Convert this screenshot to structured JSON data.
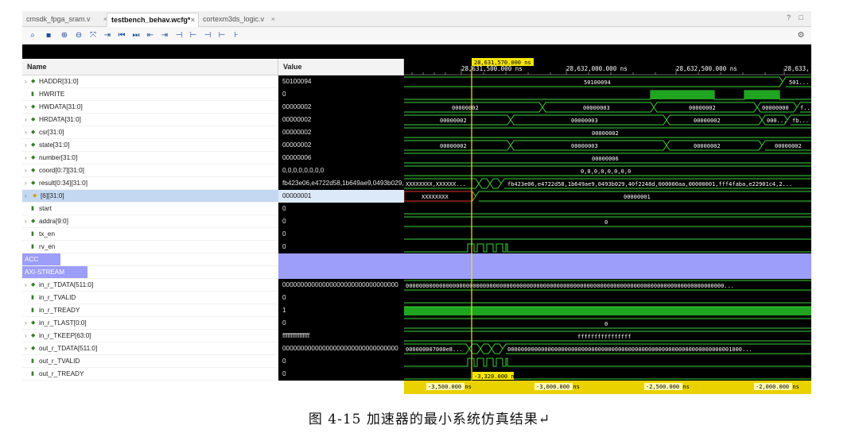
{
  "tabs": [
    {
      "label": "cmsdk_fpga_sram.v",
      "active": false
    },
    {
      "label": "testbench_behav.wcfg*",
      "active": true
    },
    {
      "label": "cortexm3ds_logic.v",
      "active": false
    }
  ],
  "tab_close_glyph": "×",
  "window_controls": "? □",
  "columns": {
    "name": "Name",
    "value": "Value"
  },
  "signals": [
    {
      "name": "HADDR[31:0]",
      "value": "50100094",
      "kind": "bus",
      "expandable": true
    },
    {
      "name": "HWRITE",
      "value": "0",
      "kind": "bit",
      "expandable": false
    },
    {
      "name": "HWDATA[31:0]",
      "value": "00000002",
      "kind": "bus",
      "expandable": true
    },
    {
      "name": "HRDATA[31:0]",
      "value": "00000002",
      "kind": "bus",
      "expandable": true
    },
    {
      "name": "csr[31:0]",
      "value": "00000002",
      "kind": "bus",
      "expandable": true
    },
    {
      "name": "state[31:0]",
      "value": "00000002",
      "kind": "bus",
      "expandable": true
    },
    {
      "name": "number[31:0]",
      "value": "00000006",
      "kind": "bus",
      "expandable": true
    },
    {
      "name": "coord[0:7][31:0]",
      "value": "0,0,0,0,0,0,0,0",
      "kind": "bus",
      "expandable": true
    },
    {
      "name": "result[0:34][31:0]",
      "value": "fb423e06,e4722d58,1b649ae9,0493b029,4",
      "kind": "bus",
      "expandable": true
    },
    {
      "name": "[6][31:0]",
      "value": "00000001",
      "kind": "bus",
      "expandable": true,
      "selected": true
    },
    {
      "name": "start",
      "value": "0",
      "kind": "bit",
      "expandable": false
    },
    {
      "name": "addra[9:0]",
      "value": "0",
      "kind": "bus",
      "expandable": true
    },
    {
      "name": "tx_en",
      "value": "0",
      "kind": "bit",
      "expandable": false
    },
    {
      "name": "rv_en",
      "value": "0",
      "kind": "bit",
      "expandable": false
    },
    {
      "name": "ACC",
      "value": "",
      "kind": "group",
      "expandable": false
    },
    {
      "name": "AXI-STREAM",
      "value": "",
      "kind": "group",
      "expandable": false
    },
    {
      "name": "in_r_TDATA[511:0]",
      "value": "00000000000000000000000000000000",
      "kind": "bus",
      "expandable": true
    },
    {
      "name": "in_r_TVALID",
      "value": "0",
      "kind": "bit",
      "expandable": false
    },
    {
      "name": "in_r_TREADY",
      "value": "1",
      "kind": "bit",
      "expandable": false
    },
    {
      "name": "in_r_TLAST[0:0]",
      "value": "0",
      "kind": "bus",
      "expandable": true
    },
    {
      "name": "in_r_TKEEP[63:0]",
      "value": "ffffffffffffffff",
      "kind": "bus",
      "expandable": true
    },
    {
      "name": "out_r_TDATA[511:0]",
      "value": "00000000000000000000000000000000",
      "kind": "bus",
      "expandable": true
    },
    {
      "name": "out_r_TVALID",
      "value": "0",
      "kind": "bit",
      "expandable": false
    },
    {
      "name": "out_r_TREADY",
      "value": "0",
      "kind": "bit",
      "expandable": false
    }
  ],
  "timeline": {
    "cursor_time": "28,631,570.000 ns",
    "ticks": [
      "28,631,500.000 ns",
      "28,632,000.000 ns",
      "28,632,500.000 ns",
      "28,633,"
    ],
    "delta_labels": [
      "-3,500.000 ns",
      "-3,000.000 ns",
      "-2,500.000 ns",
      "-2,000.000 ns"
    ],
    "cursor_delta": "-3,320.000 ns"
  },
  "wave_text": {
    "haddr": [
      "50100094",
      "501..."
    ],
    "hwdata": [
      "00000002",
      "00000003",
      "00000002",
      "00000000",
      "f..."
    ],
    "hrdata": [
      "00000002",
      "00000003",
      "00000002",
      "000...",
      "fb..."
    ],
    "csr": [
      "00000002"
    ],
    "state": [
      "00000002",
      "00000003",
      "00000002",
      "00000002"
    ],
    "number": [
      "00000006"
    ],
    "coord": [
      "0,0,0,0,0,0,0,0"
    ],
    "result": [
      "XXXXXXXX,XXXXXX...",
      "fb423e06,e4722d58,1b649ae9,0493b029,40f2248d,000000aa,00000001,fff4faba,e22901c4,2..."
    ],
    "item6": [
      "XXXXXXXX",
      "00000001"
    ],
    "addra": [
      "0"
    ],
    "in_tdata": [
      "00000000000000000000000000000000000000000000000000000000000000000000000000000000000000000000000..."
    ],
    "in_tlast": [
      "0"
    ],
    "in_tkeep": [
      "ffffffffffffffff"
    ],
    "out_tdata": [
      "000000007000e8...",
      "0000000000000000000000000000000000000000000000000000000000000000001000..."
    ]
  },
  "caption": "图 4-15 加速器的最小系统仿真结果↵"
}
